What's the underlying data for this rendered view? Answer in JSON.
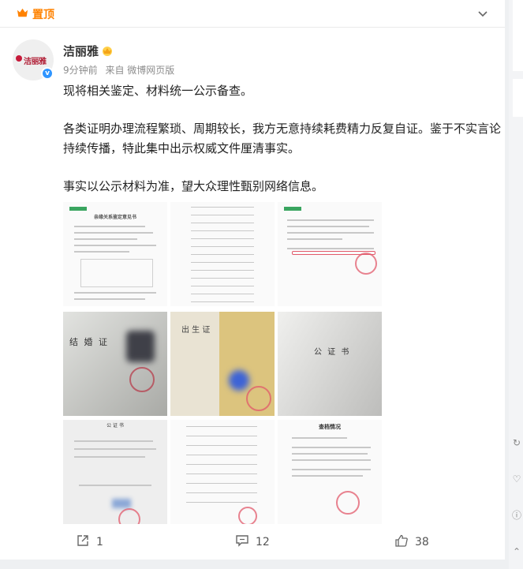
{
  "topbar": {
    "pin_label": "置顶"
  },
  "user": {
    "name": "洁丽雅",
    "avatar_text": "洁丽雅"
  },
  "meta": {
    "time": "9分钟前",
    "source": "来自 微博网页版"
  },
  "post": {
    "p1": "现将相关鉴定、材料统一公示备查。",
    "p2": "各类证明办理流程繁琐、周期较长，我方无意持续耗费精力反复自证。鉴于不实言论持续传播，特此集中出示权威文件厘清事实。",
    "p3": "事实以公示材料为准，望大众理性甄别网络信息。"
  },
  "images": [
    {
      "kind": "report",
      "caption": "亲缘关系鉴定意见书"
    },
    {
      "kind": "table"
    },
    {
      "kind": "report2"
    },
    {
      "kind": "photo",
      "caption": "结 婚 证"
    },
    {
      "kind": "photo",
      "caption": "出 生 证"
    },
    {
      "kind": "photo",
      "caption": "公 证 书"
    },
    {
      "kind": "notary",
      "caption": "公 证 书"
    },
    {
      "kind": "table"
    },
    {
      "kind": "letter",
      "caption": "查档情况"
    }
  ],
  "actions": {
    "share_count": "1",
    "comment_count": "12",
    "like_count": "38"
  },
  "colors": {
    "accent": "#ff8200",
    "verify": "#2f95ff",
    "brand": "#b01d35"
  }
}
